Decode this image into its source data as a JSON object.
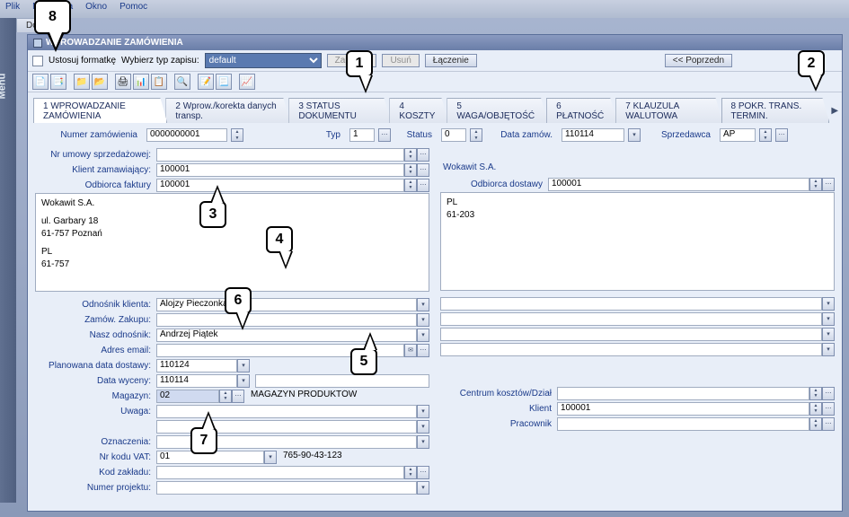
{
  "menu": {
    "plik": "Plik",
    "narz": "Narzędzia",
    "okno": "Okno",
    "pomoc": "Pomoc",
    "side": "Menu"
  },
  "topTabs": {
    "t1": "Dost"
  },
  "window": {
    "title": "WPROWADZANIE ZAMÓWIENIA"
  },
  "toolbar": {
    "ustosuj": "Ustosuj formatkę",
    "wybierz": "Wybierz typ zapisu:",
    "select": "default",
    "zapisz": "Zapisz...",
    "usun": "Usuń",
    "laczenie": "Łączenie",
    "poprz": "<< Poprzedn"
  },
  "tabs": {
    "t1": "1 WPROWADZANIE ZAMÓWIENIA",
    "t2": "2 Wprow./korekta danych transp.",
    "t3": "3 STATUS DOKUMENTU",
    "t4": "4 KOSZTY",
    "t5": "5 WAGA/OBJĘTOŚĆ",
    "t6": "6 PŁATNOŚĆ",
    "t7": "7 KLAUZULA WALUTOWA",
    "t8": "8 POKR. TRANS. TERMIN."
  },
  "top": {
    "numerzam_l": "Numer zamówienia",
    "numerzam_v": "0000000001",
    "typ_l": "Typ",
    "typ_v": "1",
    "status_l": "Status",
    "status_v": "0",
    "datazam_l": "Data zamów.",
    "datazam_v": "110114",
    "sprzed_l": "Sprzedawca",
    "sprzed_v": "AP"
  },
  "left": {
    "nrumowy_l": "Nr umowy sprzedażowej:",
    "klient_l": "Klient zamawiający:",
    "klient_v": "100001",
    "odbfakt_l": "Odbiorca faktury",
    "odbfakt_v": "100001",
    "addr_name": "Wokawit S.A.",
    "addr_street": "ul. Garbary 18",
    "addr_city": "61-757 Poznań",
    "addr_country": "PL",
    "addr_zip": "61-757",
    "odnkl_l": "Odnośnik klienta:",
    "odnkl_v": "Alojzy Pieczonka",
    "zamzak_l": "Zamów. Zakupu:",
    "naszodn_l": "Nasz odnośnik:",
    "naszodn_v": "Andrzej Piątek",
    "email_l": "Adres email:",
    "plandat_l": "Planowana data dostawy:",
    "plandat_v": "110124",
    "datawyc_l": "Data wyceny:",
    "datawyc_v": "110114",
    "magazyn_l": "Magazyn:",
    "magazyn_v": "02",
    "magazyn_desc": "MAGAZYN PRODUKTÓW",
    "uwaga_l": "Uwaga:",
    "oznacz_l": "Oznaczenia:",
    "nrvat_l": "Nr kodu VAT:",
    "nrvat_v": "01",
    "nrvat_num": "765-90-43-123",
    "kodzak_l": "Kod zakładu:",
    "nrproj_l": "Numer projektu:"
  },
  "right": {
    "name": "Wokawit S.A.",
    "odbdos_l": "Odbiorca dostawy",
    "odbdos_v": "100001",
    "addr_country": "PL",
    "addr_zip": "61-203",
    "centrum_l": "Centrum kosztów/Dział",
    "klient_l": "Klient",
    "klient_v": "100001",
    "prac_l": "Pracownik"
  },
  "callouts": {
    "c1": "1",
    "c2": "2",
    "c3": "3",
    "c4": "4",
    "c5": "5",
    "c6": "6",
    "c7": "7",
    "c8": "8"
  }
}
